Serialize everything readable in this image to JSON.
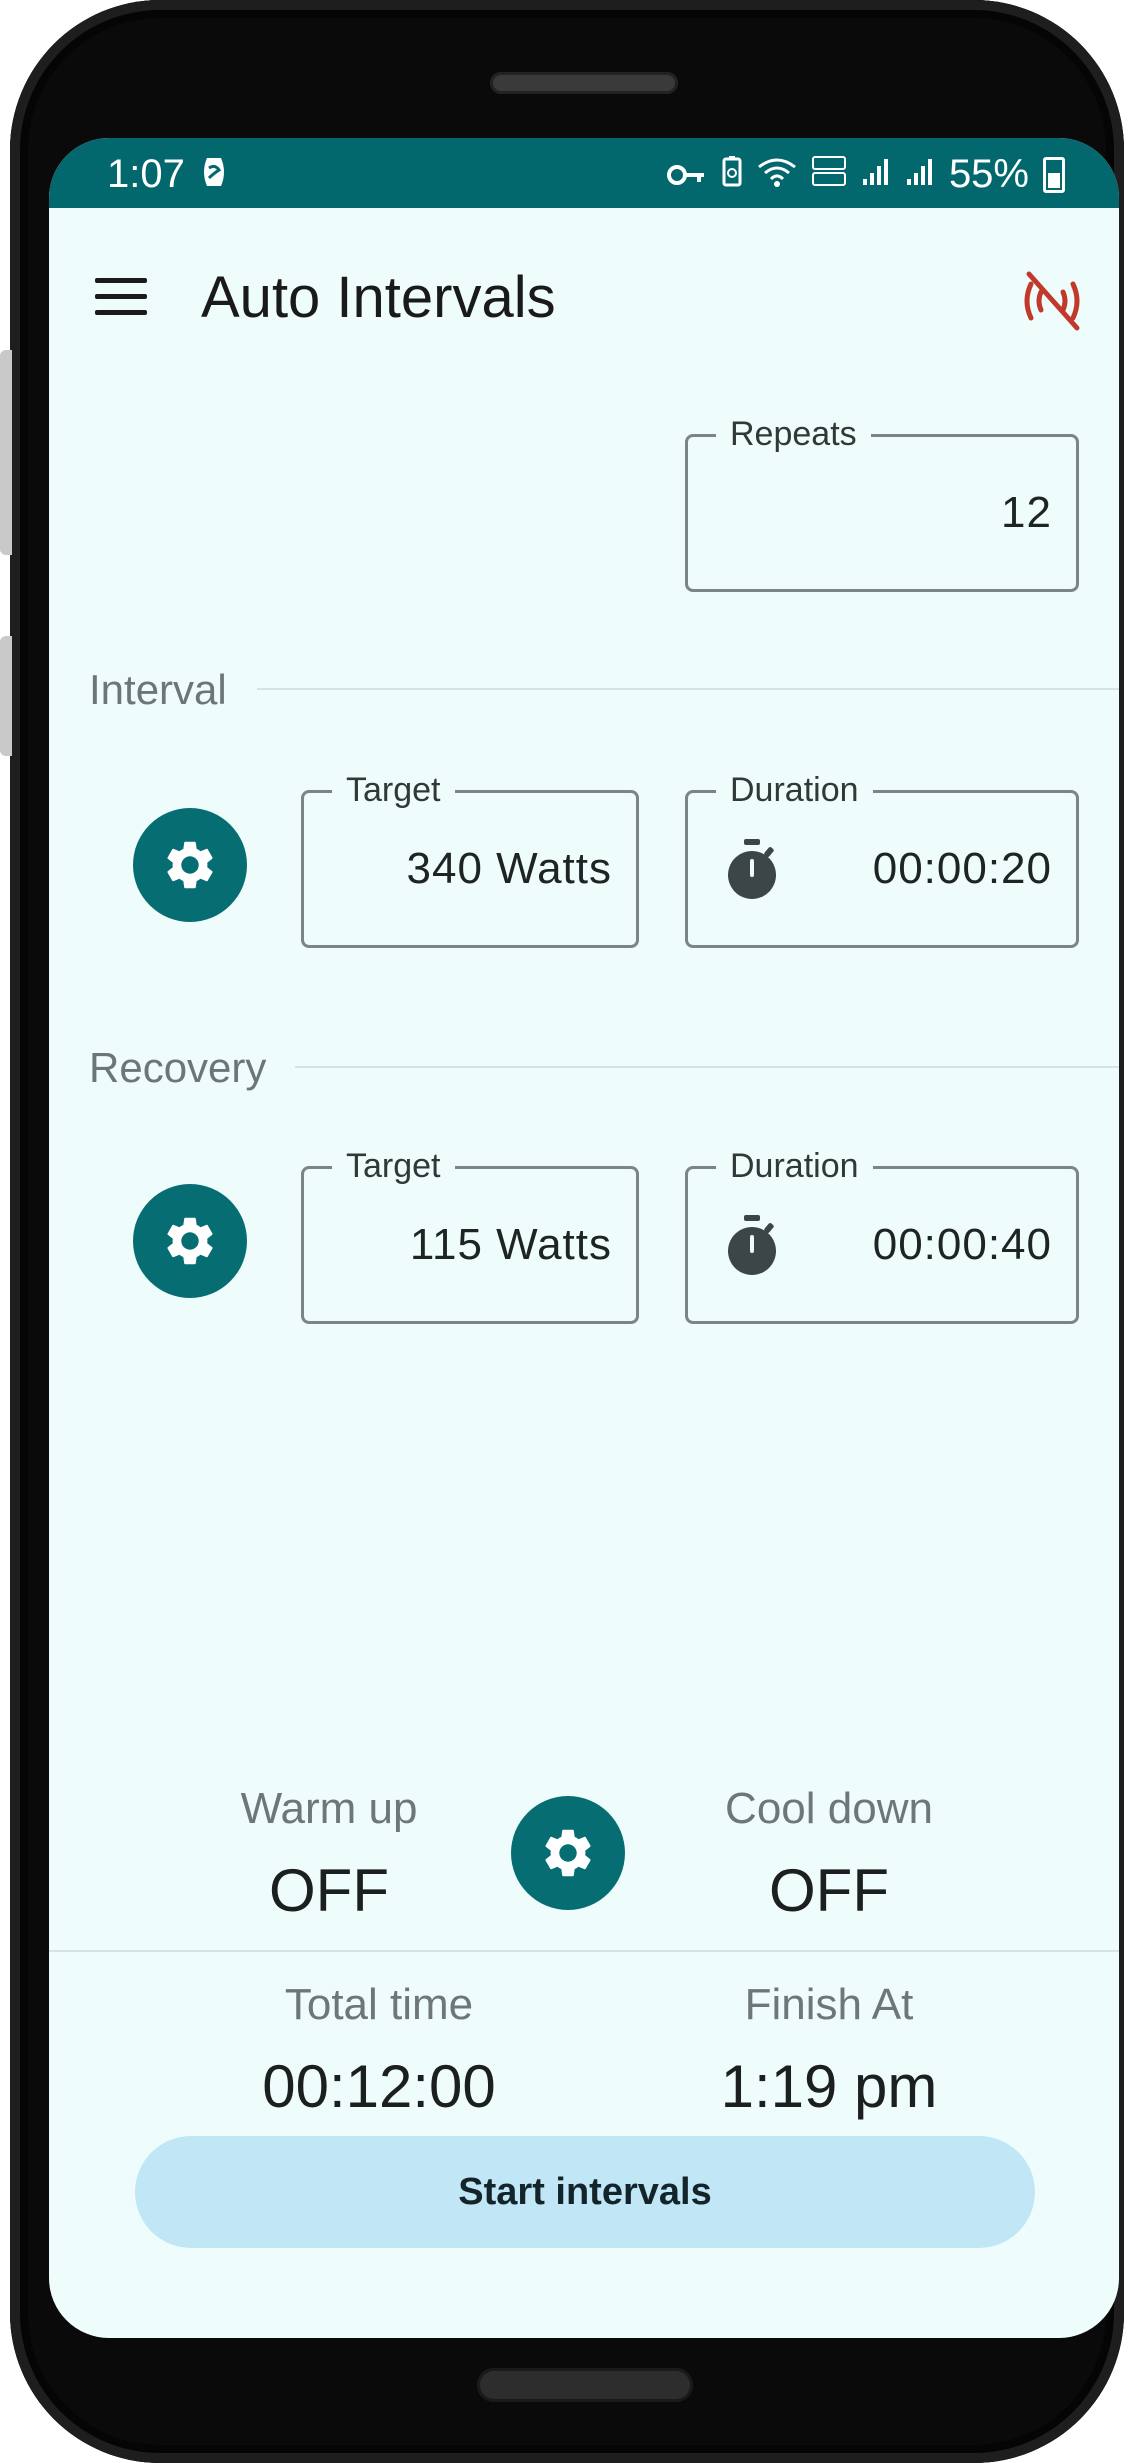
{
  "status_bar": {
    "time": "1:07",
    "battery": "55%"
  },
  "app_bar": {
    "title": "Auto Intervals"
  },
  "repeats": {
    "label": "Repeats",
    "value": "12"
  },
  "interval": {
    "section_label": "Interval",
    "target_label": "Target",
    "target_value": "340 Watts",
    "duration_label": "Duration",
    "duration_value": "00:00:20"
  },
  "recovery": {
    "section_label": "Recovery",
    "target_label": "Target",
    "target_value": "115 Watts",
    "duration_label": "Duration",
    "duration_value": "00:00:40"
  },
  "warmup": {
    "label": "Warm up",
    "value": "OFF"
  },
  "cooldown": {
    "label": "Cool down",
    "value": "OFF"
  },
  "summary": {
    "total_time_label": "Total time",
    "total_time_value": "00:12:00",
    "finish_label": "Finish At",
    "finish_value": "1:19 pm"
  },
  "actions": {
    "start_label": "Start intervals"
  },
  "colors": {
    "accent": "#066e73",
    "status_bar": "#03686e",
    "background": "#effcfc",
    "start_button": "#c1e7f6",
    "disconnected": "#c0392b"
  },
  "icons": {
    "menu": "menu-icon",
    "bluetooth_off": "bluetooth-disabled-icon",
    "settings": "gear-icon",
    "timer": "stopwatch-icon"
  }
}
